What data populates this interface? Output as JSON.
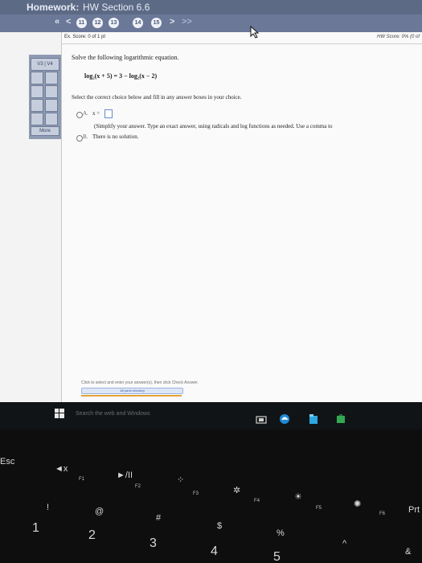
{
  "app": {
    "header_label": "Homework:",
    "header_title": "HW Section 6.6"
  },
  "nav": {
    "first": "«",
    "prev": "<",
    "questions": [
      "11",
      "12",
      "13",
      "14",
      "15"
    ],
    "next": ">",
    "last": ">>"
  },
  "left_panel": {
    "tiles": [
      "V3 | V4",
      "",
      "",
      "",
      "",
      "More"
    ]
  },
  "score": {
    "ex_score": "Ex. Score: 0 of 1 pt",
    "hw_score": "HW Score: 0% (0 of"
  },
  "question": {
    "instruction": "Solve the following logarithmic equation.",
    "equation": "log₂(x + 5) = 3 − log₂(x − 2)",
    "select_prompt": "Select the correct choice below and fill in any answer boxes in your choice.",
    "option_a_label": "A.",
    "option_a_prefix": "x =",
    "option_a_note": "(Simplify your answer. Type an exact answer, using radicals and log functions as needed. Use a comma to",
    "option_b_label": "B.",
    "option_b_text": "There is no solution."
  },
  "footer": {
    "hint": "Click to select and enter your answer(s), then click Check Answer.",
    "progress_label": "All parts showing"
  },
  "taskbar": {
    "search_placeholder": "Search the web and Windows"
  },
  "keyboard": {
    "esc": "Esc",
    "f1": "F1",
    "f2": "F2",
    "f3": "F3",
    "f4": "F4",
    "f5": "F5",
    "f6": "F6",
    "prt": "Prt",
    "mute": "◄x",
    "play": "►/II",
    "k1": "1",
    "excl": "!",
    "k2": "2",
    "at": "@",
    "k3": "3",
    "hash": "#",
    "k4": "4",
    "dollar": "$",
    "percent": "%",
    "caret": "^",
    "amp": "&",
    "k5": "5"
  }
}
